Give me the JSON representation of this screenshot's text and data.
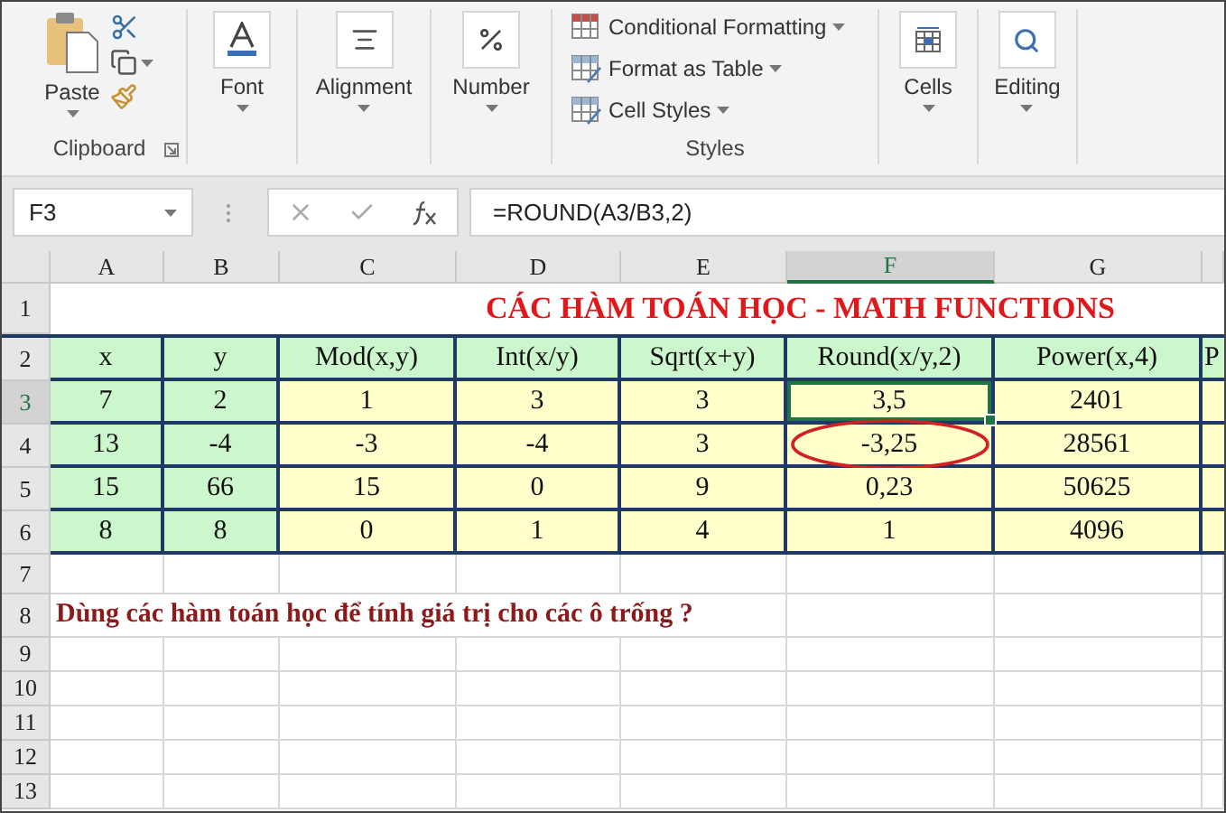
{
  "ribbon": {
    "groups": [
      {
        "kind": "clipboard",
        "label": "Clipboard",
        "button": "Paste"
      },
      {
        "kind": "font",
        "label": "Font"
      },
      {
        "kind": "alignment",
        "label": "Alignment"
      },
      {
        "kind": "number",
        "label": "Number"
      },
      {
        "kind": "styles",
        "label": "Styles",
        "items": [
          "Conditional Formatting",
          "Format as Table",
          "Cell Styles"
        ]
      },
      {
        "kind": "cells",
        "label": "Cells"
      },
      {
        "kind": "editing",
        "label": "Editing"
      }
    ]
  },
  "formula_bar": {
    "name_box": "F3",
    "formula": "=ROUND(A3/B3,2)"
  },
  "sheet": {
    "columns": [
      {
        "label": "A",
        "selected": false
      },
      {
        "label": "B",
        "selected": false
      },
      {
        "label": "C",
        "selected": false
      },
      {
        "label": "D",
        "selected": false
      },
      {
        "label": "E",
        "selected": false
      },
      {
        "label": "F",
        "selected": true
      },
      {
        "label": "G",
        "selected": false
      }
    ],
    "rows": [
      {
        "number": "1",
        "kind": "title",
        "selected": false,
        "text": "CÁC HÀM TOÁN HỌC - MATH FUNCTIONS"
      },
      {
        "number": "2",
        "kind": "header",
        "selected": false,
        "cells": [
          "x",
          "y",
          "Mod(x,y)",
          "Int(x/y)",
          "Sqrt(x+y)",
          "Round(x/y,2)",
          "Power(x,4)",
          "P"
        ]
      },
      {
        "number": "3",
        "kind": "data",
        "selected": true,
        "cells": [
          {
            "text": "7",
            "selected": false,
            "circled": false
          },
          {
            "text": "2",
            "selected": false,
            "circled": false
          },
          {
            "text": "1",
            "selected": false,
            "circled": false
          },
          {
            "text": "3",
            "selected": false,
            "circled": false
          },
          {
            "text": "3",
            "selected": false,
            "circled": false
          },
          {
            "text": "3,5",
            "selected": true,
            "circled": false
          },
          {
            "text": "2401",
            "selected": false,
            "circled": false
          }
        ]
      },
      {
        "number": "4",
        "kind": "data",
        "selected": false,
        "cells": [
          {
            "text": "13",
            "selected": false,
            "circled": false
          },
          {
            "text": "-4",
            "selected": false,
            "circled": false
          },
          {
            "text": "-3",
            "selected": false,
            "circled": false
          },
          {
            "text": "-4",
            "selected": false,
            "circled": false
          },
          {
            "text": "3",
            "selected": false,
            "circled": false
          },
          {
            "text": "-3,25",
            "selected": false,
            "circled": true
          },
          {
            "text": "28561",
            "selected": false,
            "circled": false
          }
        ]
      },
      {
        "number": "5",
        "kind": "data",
        "selected": false,
        "cells": [
          {
            "text": "15",
            "selected": false,
            "circled": false
          },
          {
            "text": "66",
            "selected": false,
            "circled": false
          },
          {
            "text": "15",
            "selected": false,
            "circled": false
          },
          {
            "text": "0",
            "selected": false,
            "circled": false
          },
          {
            "text": "9",
            "selected": false,
            "circled": false
          },
          {
            "text": "0,23",
            "selected": false,
            "circled": false
          },
          {
            "text": "50625",
            "selected": false,
            "circled": false
          }
        ]
      },
      {
        "number": "6",
        "kind": "data",
        "selected": false,
        "cells": [
          {
            "text": "8",
            "selected": false,
            "circled": false
          },
          {
            "text": "8",
            "selected": false,
            "circled": false
          },
          {
            "text": "0",
            "selected": false,
            "circled": false
          },
          {
            "text": "1",
            "selected": false,
            "circled": false
          },
          {
            "text": "4",
            "selected": false,
            "circled": false
          },
          {
            "text": "1",
            "selected": false,
            "circled": false
          },
          {
            "text": "4096",
            "selected": false,
            "circled": false
          }
        ]
      },
      {
        "number": "7",
        "kind": "empty",
        "selected": false
      },
      {
        "number": "8",
        "kind": "note",
        "selected": false,
        "text": "Dùng các hàm toán học để tính giá trị cho các ô trống ?"
      },
      {
        "number": "9",
        "kind": "empty",
        "selected": false
      },
      {
        "number": "10",
        "kind": "empty",
        "selected": false
      },
      {
        "number": "11",
        "kind": "empty",
        "selected": false
      },
      {
        "number": "12",
        "kind": "empty",
        "selected": false
      },
      {
        "number": "13",
        "kind": "empty",
        "selected": false
      }
    ]
  }
}
